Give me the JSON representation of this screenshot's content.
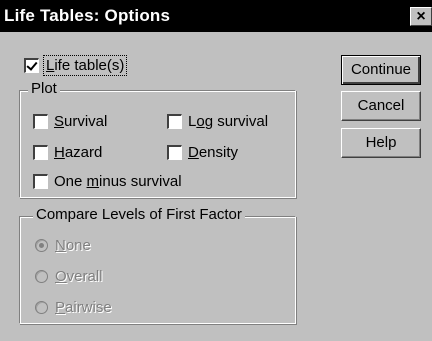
{
  "window": {
    "title": "Life Tables: Options",
    "close_glyph": "×"
  },
  "life_tables": {
    "label_pre": "",
    "label_mnemonic": "L",
    "label_post": "ife table(s)",
    "checked": true
  },
  "plot": {
    "legend": "Plot",
    "survival": {
      "pre": "",
      "mn": "S",
      "post": "urvival",
      "checked": false
    },
    "log_survival": {
      "pre": "L",
      "mn": "o",
      "post": "g survival",
      "checked": false
    },
    "hazard": {
      "pre": "",
      "mn": "H",
      "post": "azard",
      "checked": false
    },
    "density": {
      "pre": "",
      "mn": "D",
      "post": "ensity",
      "checked": false
    },
    "one_minus": {
      "pre": "One ",
      "mn": "m",
      "post": "inus survival",
      "checked": false
    }
  },
  "compare": {
    "legend": "Compare Levels of First Factor",
    "none": {
      "pre": "",
      "mn": "N",
      "post": "one",
      "selected": true
    },
    "overall": {
      "pre": "",
      "mn": "O",
      "post": "verall",
      "selected": false
    },
    "pairwise": {
      "pre": "",
      "mn": "P",
      "post": "airwise",
      "selected": false
    },
    "enabled": false
  },
  "buttons": {
    "continue": "Continue",
    "cancel": "Cancel",
    "help": "Help"
  }
}
